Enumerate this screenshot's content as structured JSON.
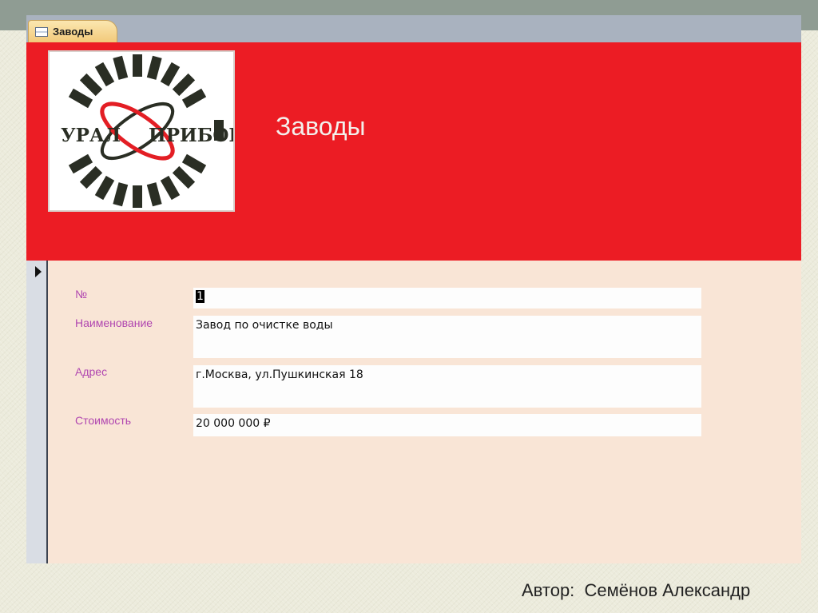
{
  "window": {
    "tab_label": "Заводы",
    "tab_icon": "form-icon"
  },
  "header": {
    "title": "Заводы",
    "background_color": "#ec1c24",
    "logo": {
      "left_text": "УРАЛ",
      "right_text": "ПРИБОР"
    }
  },
  "form": {
    "fields": {
      "number": {
        "label": "№",
        "value": "1"
      },
      "name": {
        "label": "Наименование",
        "value": "Завод по очистке воды"
      },
      "address": {
        "label": "Адрес",
        "value": "г.Москва, ул.Пушкинская 18"
      },
      "cost": {
        "label": "Стоимость",
        "value": "20 000 000 ₽"
      }
    }
  },
  "footer": {
    "author": "Автор:  Семёнов Александр"
  }
}
